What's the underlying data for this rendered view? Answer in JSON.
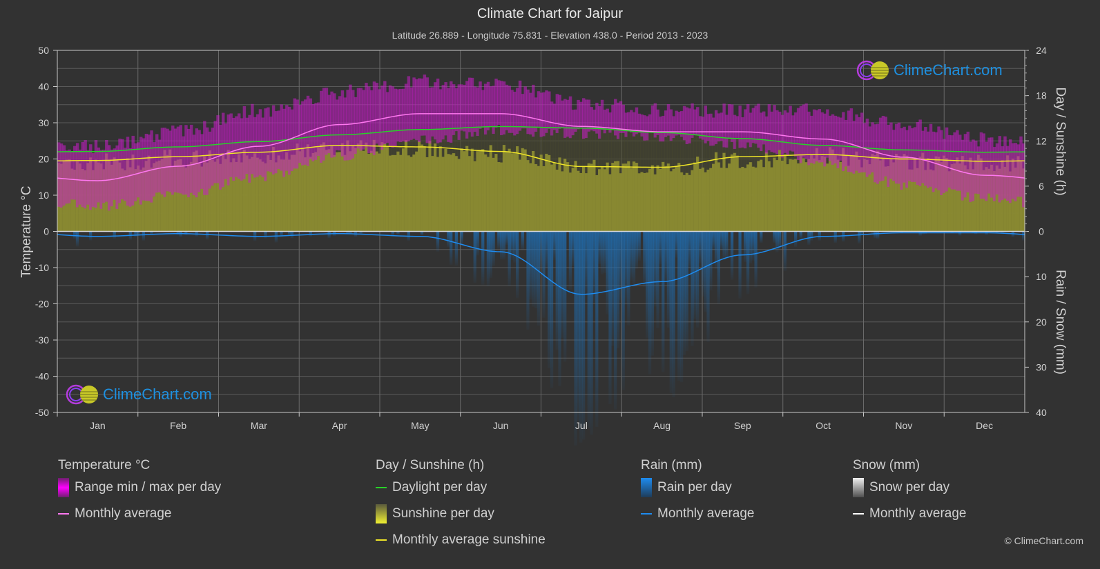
{
  "header": {
    "title": "Climate Chart for Jaipur",
    "subtitle": "Latitude 26.889 - Longitude 75.831 - Elevation 438.0 - Period 2013 - 2023"
  },
  "watermark": {
    "logo_text": "ClimeChart.com"
  },
  "copyright": "© ClimeChart.com",
  "colors": {
    "background": "#323232",
    "temp_range": "#c81ec8",
    "temp_avg": "#ff78f0",
    "daylight": "#28d228",
    "sunshine_fill": "#8c8c32",
    "sunshine_avg": "#f0e628",
    "rain_fill": "#1e64a0",
    "rain_avg": "#1e8cf0",
    "snow_avg": "#ffffff",
    "grid": "#5a5a5a",
    "logo_blue": "#1e90e0"
  },
  "legend": {
    "groups": [
      {
        "title": "Temperature °C",
        "items": [
          {
            "label": "Range min / max per day",
            "type": "swatch",
            "icon": "temp-range-swatch"
          },
          {
            "label": "Monthly average",
            "type": "line",
            "icon": "temp-avg-line"
          }
        ]
      },
      {
        "title": "Day / Sunshine (h)",
        "items": [
          {
            "label": "Daylight per day",
            "type": "line",
            "icon": "daylight-line"
          },
          {
            "label": "Sunshine per day",
            "type": "swatch",
            "icon": "sunshine-swatch"
          },
          {
            "label": "Monthly average sunshine",
            "type": "line",
            "icon": "sunshine-avg-line"
          }
        ]
      },
      {
        "title": "Rain (mm)",
        "items": [
          {
            "label": "Rain per day",
            "type": "swatch",
            "icon": "rain-swatch"
          },
          {
            "label": "Monthly average",
            "type": "line",
            "icon": "rain-avg-line"
          }
        ]
      },
      {
        "title": "Snow (mm)",
        "items": [
          {
            "label": "Snow per day",
            "type": "swatch",
            "icon": "snow-swatch"
          },
          {
            "label": "Monthly average",
            "type": "line",
            "icon": "snow-avg-line"
          }
        ]
      }
    ]
  },
  "chart_data": {
    "type": "area",
    "title": "Climate Chart for Jaipur",
    "categories": [
      "Jan",
      "Feb",
      "Mar",
      "Apr",
      "May",
      "Jun",
      "Jul",
      "Aug",
      "Sep",
      "Oct",
      "Nov",
      "Dec"
    ],
    "y_left": {
      "label": "Temperature °C",
      "range": [
        -50,
        50
      ],
      "ticks": [
        50,
        40,
        30,
        20,
        10,
        0,
        -10,
        -20,
        -30,
        -40,
        -50
      ]
    },
    "y_right_top": {
      "label": "Day / Sunshine (h)",
      "range": [
        0,
        24
      ],
      "ticks": [
        24,
        18,
        12,
        6,
        0
      ]
    },
    "y_right_bottom": {
      "label": "Rain / Snow (mm)",
      "range": [
        0,
        40
      ],
      "ticks": [
        0,
        10,
        20,
        30,
        40
      ]
    },
    "grid": true,
    "series": [
      {
        "name": "Temperature monthly average",
        "unit": "°C",
        "axis": "left",
        "values": [
          14.0,
          18.0,
          23.5,
          29.5,
          32.5,
          32.5,
          29.0,
          27.5,
          27.5,
          25.5,
          20.5,
          15.5
        ]
      },
      {
        "name": "Temperature daily max (approx. monthly)",
        "unit": "°C",
        "axis": "left",
        "values": [
          23,
          27,
          33,
          38,
          41,
          40,
          35,
          33,
          33,
          33,
          29,
          25
        ]
      },
      {
        "name": "Temperature daily min (approx. monthly)",
        "unit": "°C",
        "axis": "left",
        "values": [
          7,
          10,
          15,
          21,
          25,
          28,
          27,
          26,
          24,
          19,
          13,
          9
        ]
      },
      {
        "name": "Daylight per day",
        "unit": "h",
        "axis": "right_top",
        "values": [
          10.6,
          11.2,
          11.9,
          12.8,
          13.5,
          13.9,
          13.7,
          13.1,
          12.3,
          11.4,
          10.8,
          10.5
        ]
      },
      {
        "name": "Monthly average sunshine",
        "unit": "h",
        "axis": "right_top",
        "values": [
          9.4,
          9.9,
          10.5,
          11.4,
          11.2,
          10.6,
          8.6,
          8.5,
          9.9,
          10.2,
          9.6,
          9.3
        ]
      },
      {
        "name": "Rain monthly average",
        "unit": "mm",
        "axis": "right_bottom",
        "values": [
          1.1,
          0.5,
          1.1,
          0.5,
          1.1,
          4.5,
          13.9,
          11.1,
          5.2,
          1.1,
          0.3,
          0.3
        ]
      },
      {
        "name": "Snow monthly average",
        "unit": "mm",
        "axis": "right_bottom",
        "values": [
          0,
          0,
          0,
          0,
          0,
          0,
          0,
          0,
          0,
          0,
          0,
          0
        ]
      }
    ]
  }
}
